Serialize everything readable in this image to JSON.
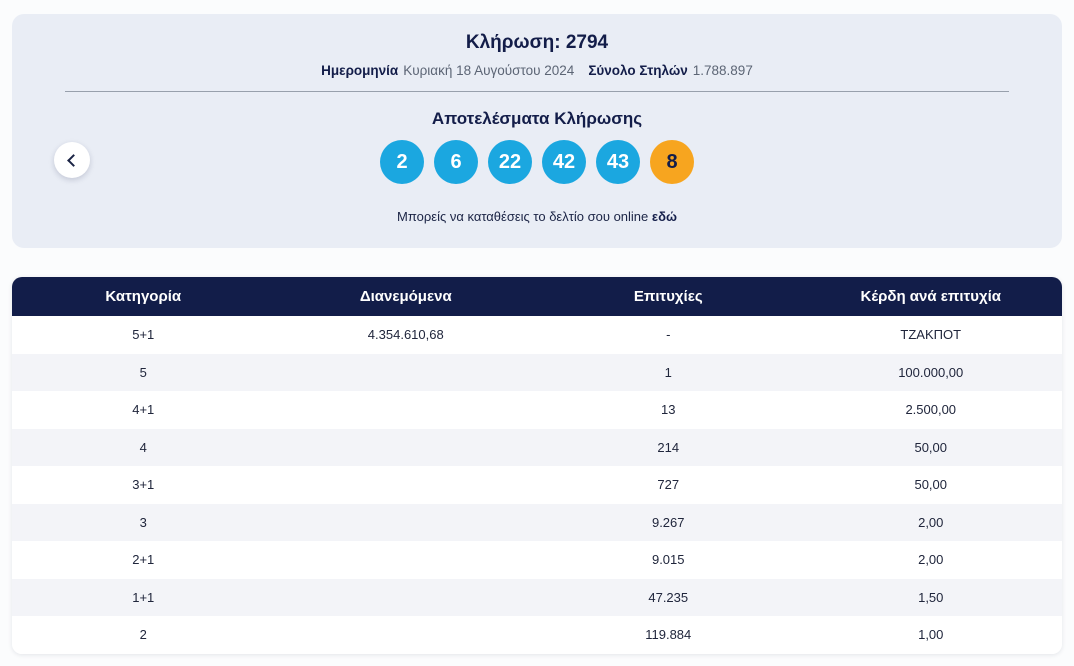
{
  "colors": {
    "navy": "#121d49",
    "ball_blue": "#1ba7e0",
    "ball_orange": "#f7a51f",
    "card_background": "#e9edf5",
    "row_alternate": "#f3f4f8",
    "muted_text": "#5c6575"
  },
  "nav": {
    "prev_icon": "chevron-left"
  },
  "draw": {
    "title_label": "Κλήρωση:",
    "title_number": "2794",
    "date_label": "Ημερομηνία",
    "date_value": "Κυριακή 18 Αυγούστου 2024",
    "columns_label": "Σύνολο Στηλών",
    "columns_value": "1.788.897",
    "results_heading": "Αποτελέσματα Κλήρωσης",
    "numbers": [
      {
        "value": "2",
        "style": "main"
      },
      {
        "value": "6",
        "style": "main"
      },
      {
        "value": "22",
        "style": "main"
      },
      {
        "value": "42",
        "style": "main"
      },
      {
        "value": "43",
        "style": "main"
      },
      {
        "value": "8",
        "style": "bonus"
      }
    ],
    "online_text": "Μπορείς να καταθέσεις το δελτίο σου online",
    "online_link_text": "εδώ"
  },
  "table": {
    "headers": [
      {
        "label": "Κατηγορία"
      },
      {
        "label": "Διανεμόμενα"
      },
      {
        "label": "Επιτυχίες"
      },
      {
        "label": "Κέρδη ανά επιτυχία"
      }
    ],
    "rows": [
      {
        "category": "5+1",
        "distributed": "4.354.610,68",
        "winners": "-",
        "prize": "ΤΖΑΚΠΟΤ"
      },
      {
        "category": "5",
        "distributed": "",
        "winners": "1",
        "prize": "100.000,00"
      },
      {
        "category": "4+1",
        "distributed": "",
        "winners": "13",
        "prize": "2.500,00"
      },
      {
        "category": "4",
        "distributed": "",
        "winners": "214",
        "prize": "50,00"
      },
      {
        "category": "3+1",
        "distributed": "",
        "winners": "727",
        "prize": "50,00"
      },
      {
        "category": "3",
        "distributed": "",
        "winners": "9.267",
        "prize": "2,00"
      },
      {
        "category": "2+1",
        "distributed": "",
        "winners": "9.015",
        "prize": "2,00"
      },
      {
        "category": "1+1",
        "distributed": "",
        "winners": "47.235",
        "prize": "1,50"
      },
      {
        "category": "2",
        "distributed": "",
        "winners": "119.884",
        "prize": "1,00"
      }
    ]
  }
}
